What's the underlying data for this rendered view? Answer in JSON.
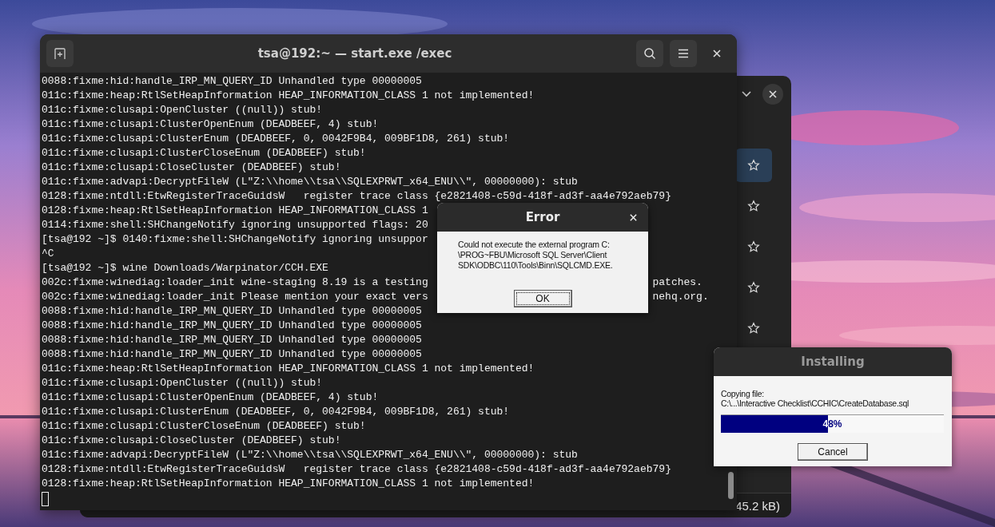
{
  "files_window": {
    "stars": [
      {
        "selected": true
      },
      {
        "selected": false
      },
      {
        "selected": false
      },
      {
        "selected": false
      },
      {
        "selected": false
      }
    ],
    "status": "45.2 kB)"
  },
  "terminal": {
    "title": "tsa@192:~ — start.exe /exec",
    "lines": [
      {
        "text": "0088:fixme:hid:handle_IRP_MN_QUERY_ID Unhandled type 00000005"
      },
      {
        "text": "011c:fixme:heap:RtlSetHeapInformation HEAP_INFORMATION_CLASS 1 not implemented!"
      },
      {
        "text": "011c:fixme:clusapi:OpenCluster ((null)) stub!"
      },
      {
        "text": "011c:fixme:clusapi:ClusterOpenEnum (DEADBEEF, 4) stub!"
      },
      {
        "text": "011c:fixme:clusapi:ClusterEnum (DEADBEEF, 0, 0042F9B4, 009BF1D8, 261) stub!"
      },
      {
        "text": "011c:fixme:clusapi:ClusterCloseEnum (DEADBEEF) stub!"
      },
      {
        "text": "011c:fixme:clusapi:CloseCluster (DEADBEEF) stub!"
      },
      {
        "text": "011c:fixme:advapi:DecryptFileW (L\"Z:\\\\home\\\\tsa\\\\SQLEXPRWT_x64_ENU\\\\\", 00000000): stub"
      },
      {
        "text": "0128:fixme:ntdll:EtwRegisterTraceGuidsW   register trace class {e2821408-c59d-418f-ad3f-aa4e792aeb79}"
      },
      {
        "text": "0128:fixme:heap:RtlSetHeapInformation HEAP_INFORMATION_CLASS 1"
      },
      {
        "text": "0114:fixme:shell:SHChangeNotify ignoring unsupported flags: 20"
      },
      {
        "text": "[tsa@192 ~]$ 0140:fixme:shell:SHChangeNotify ignoring unsuppor"
      },
      {
        "text": "^C"
      },
      {
        "text": "[tsa@192 ~]$ wine Downloads/Warpinator/CCH.EXE"
      },
      {
        "text": "002c:fixme:winediag:loader_init wine-staging 8.19 is a testing",
        "tail": "patches."
      },
      {
        "text": "002c:fixme:winediag:loader_init Please mention your exact vers",
        "tail": "nehq.org."
      },
      {
        "text": "0088:fixme:hid:handle_IRP_MN_QUERY_ID Unhandled type 00000005"
      },
      {
        "text": "0088:fixme:hid:handle_IRP_MN_QUERY_ID Unhandled type 00000005"
      },
      {
        "text": "0088:fixme:hid:handle_IRP_MN_QUERY_ID Unhandled type 00000005"
      },
      {
        "text": "0088:fixme:hid:handle_IRP_MN_QUERY_ID Unhandled type 00000005"
      },
      {
        "text": "011c:fixme:heap:RtlSetHeapInformation HEAP_INFORMATION_CLASS 1 not implemented!"
      },
      {
        "text": "011c:fixme:clusapi:OpenCluster ((null)) stub!"
      },
      {
        "text": "011c:fixme:clusapi:ClusterOpenEnum (DEADBEEF, 4) stub!"
      },
      {
        "text": "011c:fixme:clusapi:ClusterEnum (DEADBEEF, 0, 0042F9B4, 009BF1D8, 261) stub!"
      },
      {
        "text": "011c:fixme:clusapi:ClusterCloseEnum (DEADBEEF) stub!"
      },
      {
        "text": "011c:fixme:clusapi:CloseCluster (DEADBEEF) stub!"
      },
      {
        "text": "011c:fixme:advapi:DecryptFileW (L\"Z:\\\\home\\\\tsa\\\\SQLEXPRWT_x64_ENU\\\\\", 00000000): stub"
      },
      {
        "text": "0128:fixme:ntdll:EtwRegisterTraceGuidsW   register trace class {e2821408-c59d-418f-ad3f-aa4e792aeb79}"
      },
      {
        "text": "0128:fixme:heap:RtlSetHeapInformation HEAP_INFORMATION_CLASS 1 not implemented!"
      }
    ]
  },
  "error_dialog": {
    "title": "Error",
    "message": "Could not execute the external program C:\n\\PROG~FBU\\Microsoft SQL Server\\Client\nSDK\\ODBC\\110\\Tools\\Binn\\SQLCMD.EXE.",
    "button": "OK"
  },
  "install_dialog": {
    "title": "Installing",
    "label": "Copying file:",
    "path": "C:\\...\\Interactive Checklist\\CCHIC\\CreateDatabase.sql",
    "progress": {
      "level": 0.48,
      "reading": "48%"
    },
    "button": "Cancel"
  }
}
